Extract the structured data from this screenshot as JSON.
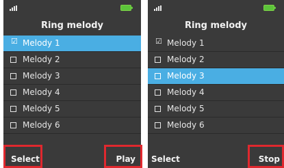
{
  "screens": [
    {
      "title": "Ring melody",
      "items": [
        "Melody 1",
        "Melody 2",
        "Melody 3",
        "Melody 4",
        "Melody 5",
        "Melody 6"
      ],
      "selected_index": 0,
      "checked_index": 0,
      "left_softkey": "Select",
      "right_softkey": "Play"
    },
    {
      "title": "Ring melody",
      "items": [
        "Melody 1",
        "Melody 2",
        "Melody 3",
        "Melody 4",
        "Melody 5",
        "Melody 6"
      ],
      "selected_index": 2,
      "checked_index": 0,
      "left_softkey": "Select",
      "right_softkey": "Stop"
    }
  ],
  "icons": {
    "signal": "signal-strength-icon",
    "battery": "battery-icon",
    "checkbox": "checkbox-icon",
    "check": "checkmark-icon"
  },
  "colors": {
    "screen_bg": "#3a3a3a",
    "selected_row": "#4aaee3",
    "battery": "#5cc43a",
    "highlight_frame": "#e0282e"
  }
}
